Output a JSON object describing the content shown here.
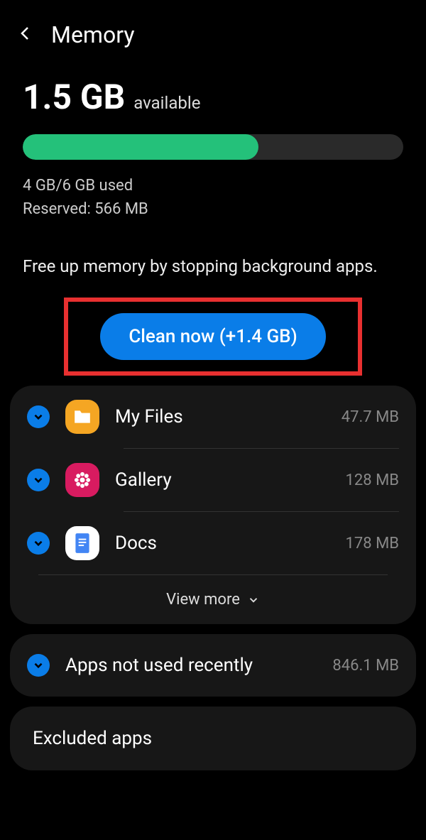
{
  "header": {
    "title": "Memory"
  },
  "memory": {
    "available_value": "1.5 GB",
    "available_label": "available",
    "progress_percent": 62,
    "used_text": "4 GB/6 GB used",
    "reserved_text": "Reserved: 566 MB"
  },
  "instruction": "Free up memory by stopping background apps.",
  "clean_button": {
    "label": "Clean now (+1.4 GB)",
    "highlight_color": "#e83030"
  },
  "apps": [
    {
      "name": "My Files",
      "size": "47.7 MB",
      "icon": "files"
    },
    {
      "name": "Gallery",
      "size": "128 MB",
      "icon": "gallery"
    },
    {
      "name": "Docs",
      "size": "178 MB",
      "icon": "docs"
    }
  ],
  "view_more_label": "View more",
  "not_used": {
    "title": "Apps not used recently",
    "size": "846.1 MB"
  },
  "excluded": {
    "title": "Excluded apps"
  }
}
